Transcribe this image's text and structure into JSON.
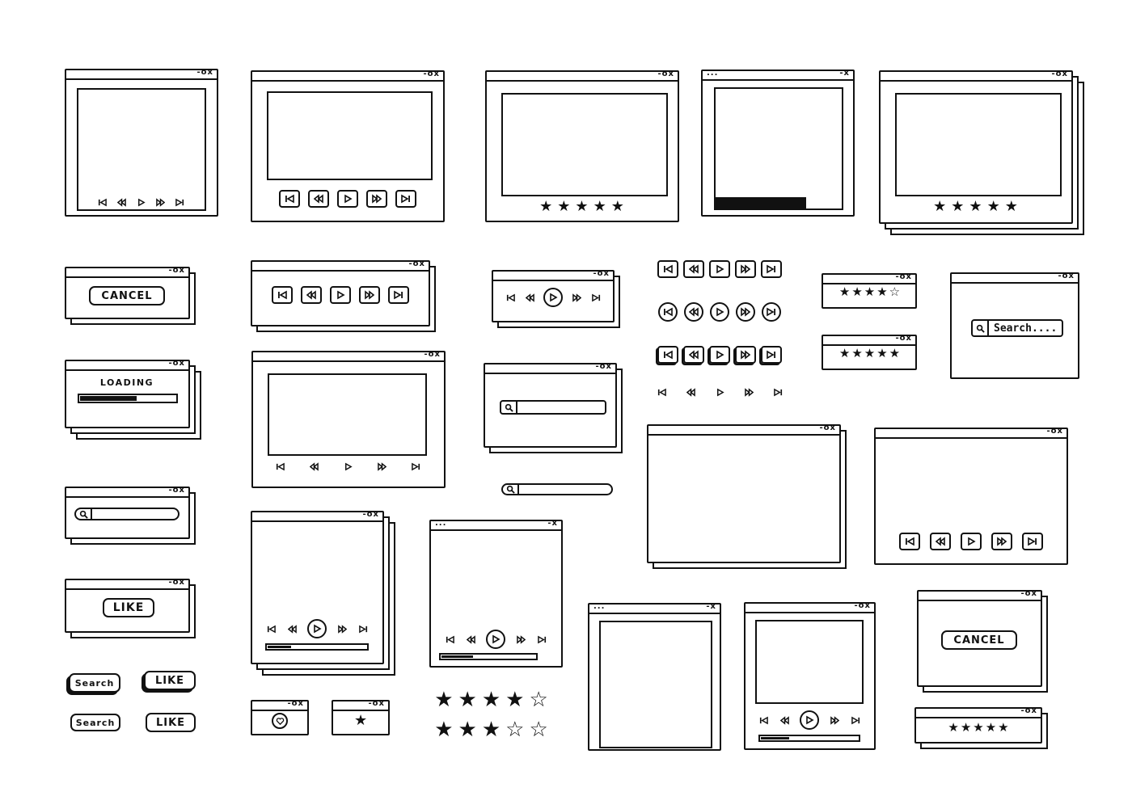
{
  "window_controls": {
    "right": "-ox",
    "left": "..."
  },
  "media_controls": [
    "skip-back-icon",
    "rewind-icon",
    "play-icon",
    "fast-forward-icon",
    "skip-forward-icon"
  ],
  "labels": {
    "cancel": "CANCEL",
    "loading": "LOADING",
    "like": "LIKE",
    "search": "Search",
    "search_placeholder": "Search...."
  },
  "loading_progress": 0.6,
  "player_progress": [
    0.25,
    0.35,
    0.3
  ],
  "ratings": {
    "window_row1_a": {
      "filled": 5,
      "total": 5
    },
    "window_row1_b": {
      "filled": 5,
      "total": 5
    },
    "rating_window_1": {
      "filled": 4,
      "total": 5
    },
    "rating_window_2": {
      "filled": 5,
      "total": 5
    },
    "rating_window_3": {
      "filled": 5,
      "total": 5
    },
    "standalone_1": {
      "filled": 4,
      "total": 5
    },
    "standalone_2": {
      "filled": 3,
      "total": 5
    }
  },
  "icons": {
    "heart": "heart-icon",
    "star": "star-icon",
    "search": "search-icon"
  },
  "colors": {
    "ink": "#111111",
    "paper": "#ffffff"
  }
}
